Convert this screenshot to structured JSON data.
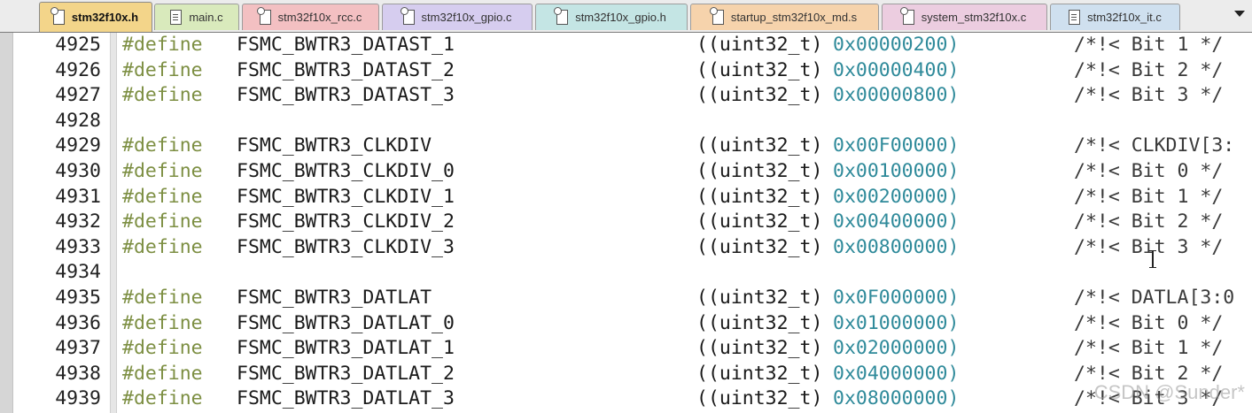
{
  "tabs": [
    {
      "label": "stm32f10x.h",
      "icon": "header-file-icon",
      "color": "#f3d58a",
      "active": true
    },
    {
      "label": "main.c",
      "icon": "c-file-icon",
      "color": "#d9eabc",
      "active": false
    },
    {
      "label": "stm32f10x_rcc.c",
      "icon": "header-file-icon",
      "color": "#f3c0c2",
      "active": false
    },
    {
      "label": "stm32f10x_gpio.c",
      "icon": "header-file-icon",
      "color": "#d6cdef",
      "active": false
    },
    {
      "label": "stm32f10x_gpio.h",
      "icon": "header-file-icon",
      "color": "#c4e5e4",
      "active": false
    },
    {
      "label": "startup_stm32f10x_md.s",
      "icon": "header-file-icon",
      "color": "#f6d3ac",
      "active": false
    },
    {
      "label": "system_stm32f10x.c",
      "icon": "header-file-icon",
      "color": "#eccde0",
      "active": false
    },
    {
      "label": "stm32f10x_it.c",
      "icon": "c-file-icon",
      "color": "#cfe0ef",
      "active": false
    }
  ],
  "lines": [
    {
      "num": "4925",
      "kw": "#define",
      "name": "FSMC_BWTR3_DATAST_1",
      "cast": "((uint32_t)",
      "hex": "0x00000200)",
      "comment": "/*!< Bit 1 */"
    },
    {
      "num": "4926",
      "kw": "#define",
      "name": "FSMC_BWTR3_DATAST_2",
      "cast": "((uint32_t)",
      "hex": "0x00000400)",
      "comment": "/*!< Bit 2 */"
    },
    {
      "num": "4927",
      "kw": "#define",
      "name": "FSMC_BWTR3_DATAST_3",
      "cast": "((uint32_t)",
      "hex": "0x00000800)",
      "comment": "/*!< Bit 3 */"
    },
    {
      "num": "4928",
      "kw": "",
      "name": "",
      "cast": "",
      "hex": "",
      "comment": ""
    },
    {
      "num": "4929",
      "kw": "#define",
      "name": "FSMC_BWTR3_CLKDIV",
      "cast": "((uint32_t)",
      "hex": "0x00F00000)",
      "comment": "/*!< CLKDIV[3:"
    },
    {
      "num": "4930",
      "kw": "#define",
      "name": "FSMC_BWTR3_CLKDIV_0",
      "cast": "((uint32_t)",
      "hex": "0x00100000)",
      "comment": "/*!< Bit 0 */"
    },
    {
      "num": "4931",
      "kw": "#define",
      "name": "FSMC_BWTR3_CLKDIV_1",
      "cast": "((uint32_t)",
      "hex": "0x00200000)",
      "comment": "/*!< Bit 1 */"
    },
    {
      "num": "4932",
      "kw": "#define",
      "name": "FSMC_BWTR3_CLKDIV_2",
      "cast": "((uint32_t)",
      "hex": "0x00400000)",
      "comment": "/*!< Bit 2 */"
    },
    {
      "num": "4933",
      "kw": "#define",
      "name": "FSMC_BWTR3_CLKDIV_3",
      "cast": "((uint32_t)",
      "hex": "0x00800000)",
      "comment": "/*!< Bit 3 */"
    },
    {
      "num": "4934",
      "kw": "",
      "name": "",
      "cast": "",
      "hex": "",
      "comment": ""
    },
    {
      "num": "4935",
      "kw": "#define",
      "name": "FSMC_BWTR3_DATLAT",
      "cast": "((uint32_t)",
      "hex": "0x0F000000)",
      "comment": "/*!< DATLA[3:0"
    },
    {
      "num": "4936",
      "kw": "#define",
      "name": "FSMC_BWTR3_DATLAT_0",
      "cast": "((uint32_t)",
      "hex": "0x01000000)",
      "comment": "/*!< Bit 0 */"
    },
    {
      "num": "4937",
      "kw": "#define",
      "name": "FSMC_BWTR3_DATLAT_1",
      "cast": "((uint32_t)",
      "hex": "0x02000000)",
      "comment": "/*!< Bit 1 */"
    },
    {
      "num": "4938",
      "kw": "#define",
      "name": "FSMC_BWTR3_DATLAT_2",
      "cast": "((uint32_t)",
      "hex": "0x04000000)",
      "comment": "/*!< Bit 2 */"
    },
    {
      "num": "4939",
      "kw": "#define",
      "name": "FSMC_BWTR3_DATLAT_3",
      "cast": "((uint32_t)",
      "hex": "0x08000000)",
      "comment": "/*!< Bit 3 */"
    }
  ],
  "watermark": "CSDN @Sunder*",
  "colors": {
    "keyword": "#7d8f43",
    "hex_literal": "#2f8a9a",
    "gutter": "#d6d6d6"
  }
}
